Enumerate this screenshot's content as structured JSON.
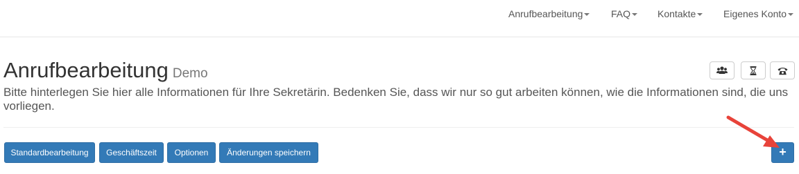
{
  "nav": {
    "items": [
      {
        "label": "Anrufbearbeitung"
      },
      {
        "label": "FAQ"
      },
      {
        "label": "Kontakte"
      },
      {
        "label": "Eigenes Konto"
      }
    ]
  },
  "header": {
    "title": "Anrufbearbeitung",
    "subtitle": "Demo",
    "icon_buttons": [
      "users-icon",
      "hourglass-icon",
      "phone-icon"
    ]
  },
  "intro_text": "Bitte hinterlegen Sie hier alle Informationen für Ihre Sekretärin. Bedenken Sie, dass wir nur so gut arbeiten können, wie die Informationen sind, die uns vorliegen.",
  "toolbar": {
    "standard_label": "Standardbearbeitung",
    "business_hours_label": "Geschäftszeit",
    "options_label": "Optionen",
    "save_label": "Änderungen speichern",
    "add_label": "+"
  },
  "colors": {
    "primary": "#337ab7",
    "annotation_arrow": "#e8433a"
  }
}
